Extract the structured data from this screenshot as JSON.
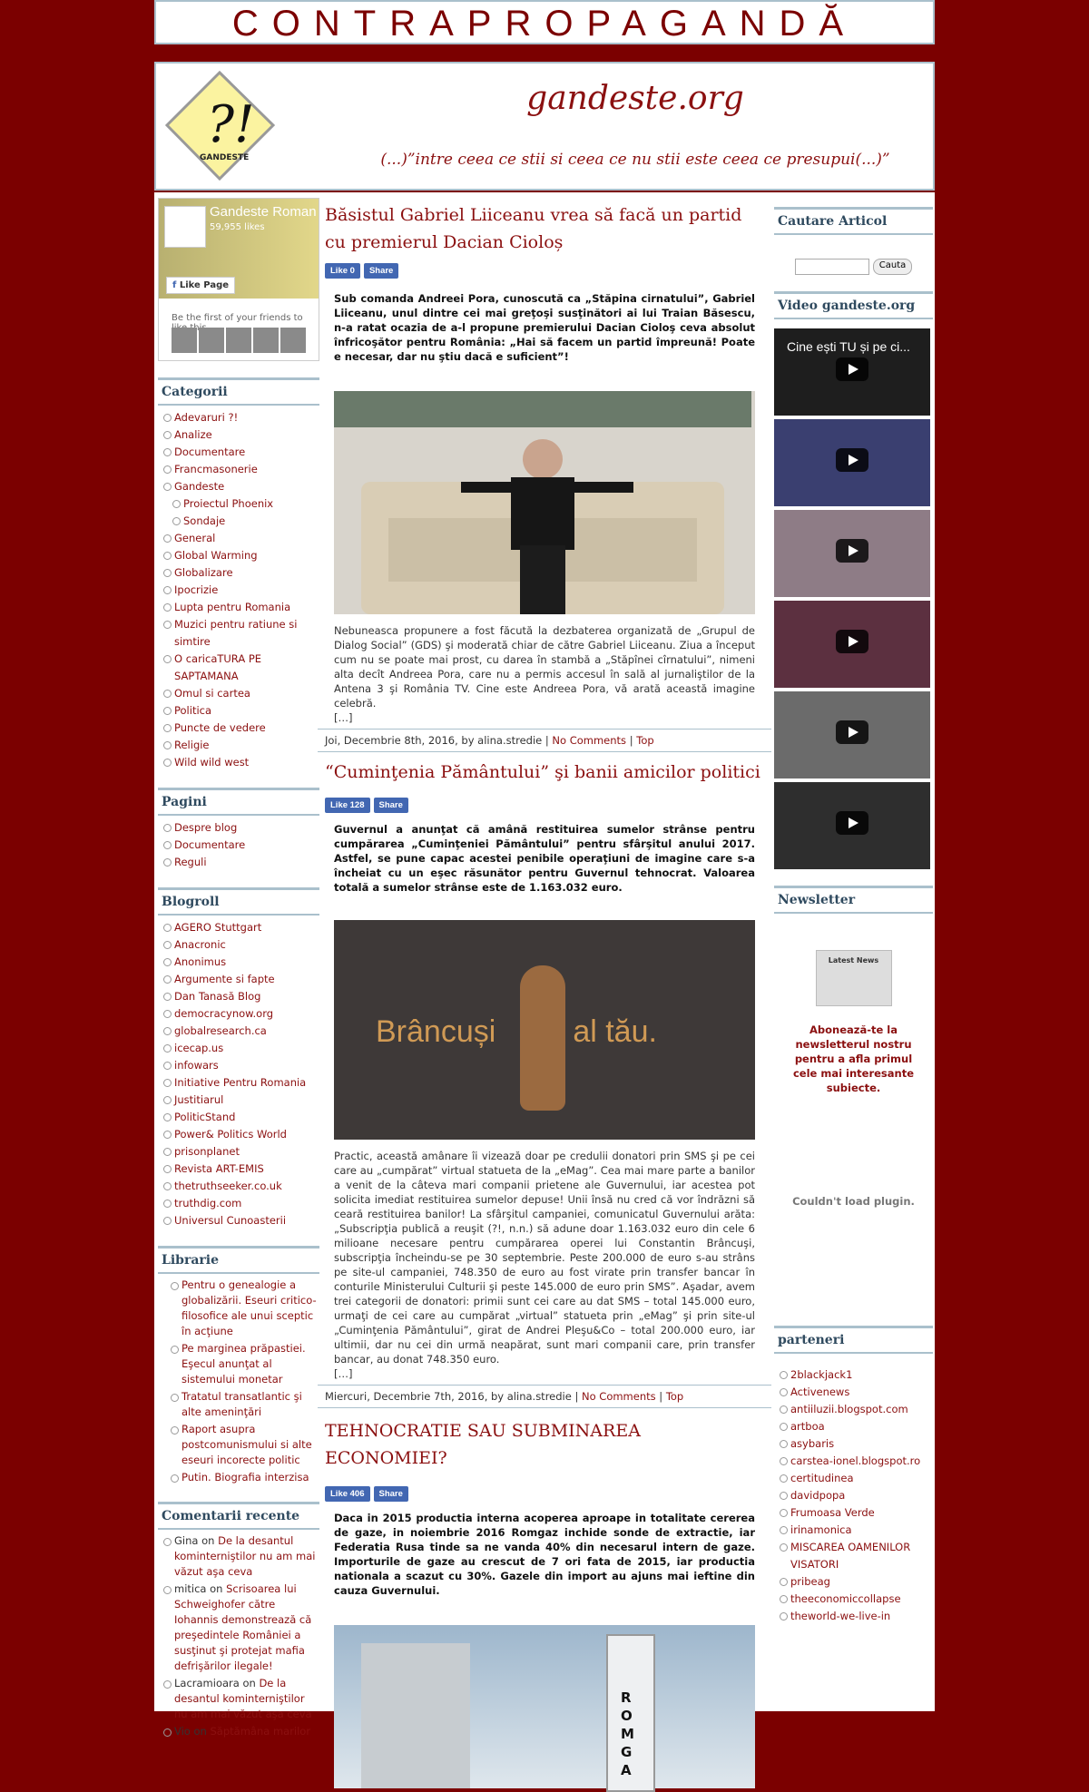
{
  "site": {
    "banner": "CONTRAPROPAGANDĂ",
    "name": "gandeste.org",
    "tagline": "(...)”intre ceea ce stii si ceea ce nu stii este ceea ce presupui(...)”",
    "logo_text": "GANDESTE"
  },
  "facebook": {
    "page_name": "Gandeste Romania",
    "likes": "59,955 likes",
    "like_page": "Like Page",
    "friends": "Be the first of your friends to like this"
  },
  "left": {
    "categories_title": "Categorii",
    "categories": [
      {
        "label": "Adevaruri ?!"
      },
      {
        "label": "Analize"
      },
      {
        "label": "Documentare"
      },
      {
        "label": "Francmasonerie"
      },
      {
        "label": "Gandeste"
      },
      {
        "label": "Proiectul Phoenix",
        "sub": true
      },
      {
        "label": "Sondaje",
        "sub": true
      },
      {
        "label": "General"
      },
      {
        "label": "Global Warming"
      },
      {
        "label": "Globalizare"
      },
      {
        "label": "Ipocrizie"
      },
      {
        "label": "Lupta pentru Romania"
      },
      {
        "label": "Muzici pentru ratiune si simtire"
      },
      {
        "label": "O caricaTURA PE SAPTAMANA"
      },
      {
        "label": "Omul si cartea"
      },
      {
        "label": "Politica"
      },
      {
        "label": "Puncte de vedere"
      },
      {
        "label": "Religie"
      },
      {
        "label": "Wild wild west"
      }
    ],
    "pages_title": "Pagini",
    "pages": [
      "Despre blog",
      "Documentare",
      "Reguli"
    ],
    "blogroll_title": "Blogroll",
    "blogroll": [
      "AGERO Stuttgart",
      "Anacronic",
      "Anonimus",
      "Argumente si fapte",
      "Dan Tanasă Blog",
      "democracynow.org",
      "globalresearch.ca",
      "icecap.us",
      "infowars",
      "Initiative Pentru Romania",
      "Justitiarul",
      "PoliticStand",
      "Power& Politics World",
      "prisonplanet",
      "Revista ART-EMIS",
      "thetruthseeker.co.uk",
      "truthdig.com",
      "Universul Cunoasterii"
    ],
    "library_title": "Librarie",
    "library": [
      "Pentru o genealogie a globalizării. Eseuri critico-filosofice ale unui sceptic în acţiune",
      "Pe marginea prăpastiei. Eşecul anunţat al sistemului monetar",
      "Tratatul transatlantic şi alte ameninţări",
      "Raport asupra postcomunismului si alte eseuri incorecte politic",
      "Putin. Biografia interzisa"
    ],
    "comments_title": "Comentarii recente",
    "comments": [
      {
        "who": "Gina",
        "on": "on",
        "what": "De la desantul kominterniştilor nu am mai văzut aşa ceva"
      },
      {
        "who": "mitica",
        "on": "on",
        "what": "Scrisoarea lui Schweighofer către Iohannis demonstrează că preşedintele României a susţinut şi protejat mafia defrişărilor ilegale!"
      },
      {
        "who": "Lacramioara",
        "on": "on",
        "what": "De la desantul kominterniştilor nu am mai văzut aşa ceva"
      },
      {
        "who": "Vio",
        "on": "on",
        "what": "Săptămâna marilor"
      }
    ]
  },
  "posts": [
    {
      "title": "Băsistul Gabriel Liiceanu vrea să facă un partid cu premierul Dacian Cioloș",
      "like": "Like 0",
      "share": "Share",
      "lead": "Sub comanda Andreei Pora, cunoscută ca „Stăpina cirnatului”, Gabriel Liiceanu, unul dintre cei mai greţoşi susţinători ai lui Traian Băsescu, n-a ratat ocazia de a-l propune premierului Dacian Cioloş ceva absolut înfricoşător pentru România: „Hai să facem un partid împreună! Poate e necesar, dar nu ştiu dacă e suficient”!",
      "body": "Nebuneasca propunere a fost făcută la dezbaterea organizată de „Grupul de Dialog Social” (GDS) şi moderată chiar de către Gabriel Liiceanu. Ziua a început cum nu se poate mai prost, cu darea în stambă a „Stăpînei cîrnatului”, nimeni alta decît Andreea Pora, care nu a permis accesul în sală al jurnaliştilor de la Antena 3 şi România TV. Cine este Andreea Pora, vă arată această imagine celebră.",
      "more": "[…]",
      "meta_date": "Joi, Decembrie 8th, 2016, by alina.stredie",
      "comments": "No Comments",
      "top": "Top"
    },
    {
      "title": "“Cuminţenia Pământului” şi banii amicilor politici",
      "like": "Like 128",
      "share": "Share",
      "lead": "Guvernul a anunţat că amână restituirea sumelor strânse pentru cumpărarea „Cuminţeniei Pământului” pentru sfârşitul anului 2017. Astfel, se pune capac acestei penibile operaţiuni de imagine care s-a încheiat cu un eşec răsunător pentru Guvernul tehnocrat. Valoarea totală a sumelor strânse este de 1.163.032 euro.",
      "image_text": "Brâncuși      e al tău.",
      "body": "Practic, această amânare îi vizează doar pe credulii donatori prin SMS şi pe cei care au „cumpărat” virtual statueta de la „eMag”. Cea mai mare parte a banilor a venit de la câteva mari companii prietene ale Guvernului, iar acestea pot solicita imediat restituirea sumelor depuse! Unii însă nu cred că vor îndrăzni să ceară restituirea banilor! La sfârşitul campaniei, comunicatul Guvernului arăta: „Subscripţia publică a reuşit (?!, n.n.) să adune doar 1.163.032 euro din cele 6 milioane necesare pentru cumpărarea operei lui Constantin Brâncuşi, subscripţia încheindu-se pe 30 septembrie. Peste 200.000 de euro s-au strâns pe site-ul campaniei, 748.350 de euro au fost virate prin transfer bancar în conturile Ministerului Culturii şi peste 145.000 de euro prin SMS”. Aşadar, avem trei categorii de donatori: primii sunt cei care au dat SMS – total 145.000 euro, urmaţi de cei care au cumpărat „virtual” statueta prin „eMag” şi prin site-ul „Cuminţenia Pământului”, girat de Andrei Pleşu&Co – total 200.000 euro, iar ultimii, dar nu cei din urmă neapărat, sunt mari companii care, prin transfer bancar, au donat 748.350 euro.",
      "more": "[…]",
      "meta_date": "Miercuri, Decembrie 7th, 2016, by alina.stredie",
      "comments": "No Comments",
      "top": "Top"
    },
    {
      "title": "TEHNOCRATIE SAU SUBMINAREA ECONOMIEI?",
      "like": "Like 406",
      "share": "Share",
      "lead": "Daca in 2015 productia interna acoperea aproape in totalitate cererea de gaze, in noiembrie 2016 Romgaz inchide sonde de extractie, iar Federatia Rusa tinde sa ne vanda 40% din necesarul intern de gaze. Importurile de gaze au crescut de 7 ori fata de 2015, iar productia nationala a scazut cu 30%. Gazele din import au ajuns mai ieftine din cauza Guvernului.",
      "image_text": "ROMGA"
    }
  ],
  "right": {
    "search_title": "Cautare Articol",
    "search_button": "Cauta",
    "video_title": "Video gandeste.org",
    "video_caption": "Cine ești TU și pe ci...",
    "newsletter_title": "Newsletter",
    "news_icon_text": "Latest News",
    "subscribe": "Abonează-te la newsletterul nostru pentru a afla primul cele mai interesante subiecte.",
    "no_plugin": "Couldn't load plugin.",
    "partners_title": "parteneri",
    "partners": [
      "2blackjack1",
      "Activenews",
      "antiiluzii.blogspot.com",
      "artboa",
      "asybaris",
      "carstea-ionel.blogspot.ro",
      "certitudinea",
      "davidpopa",
      "Frumoasa Verde",
      "irinamonica",
      "MISCAREA OAMENILOR VISATORI",
      "pribeag",
      "theeconomiccollapse",
      "theworld-we-live-in"
    ]
  }
}
